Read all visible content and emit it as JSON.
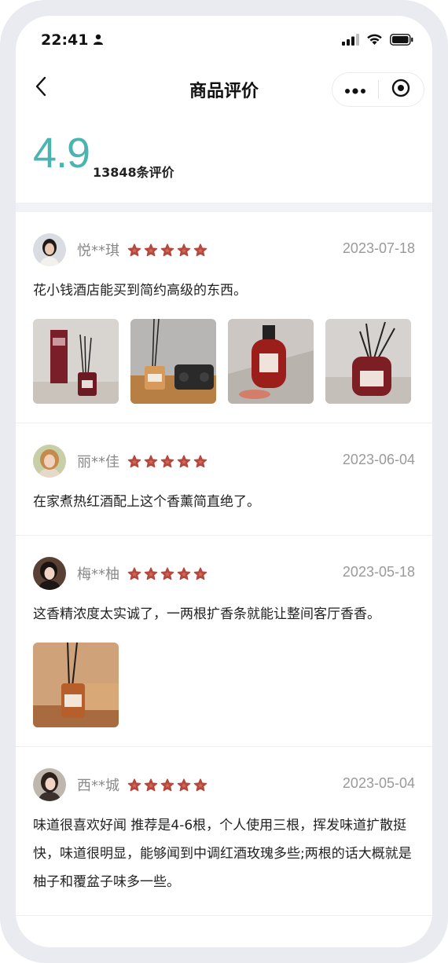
{
  "status_bar": {
    "time": "22:41"
  },
  "nav": {
    "title": "商品评价"
  },
  "summary": {
    "score": "4.9",
    "count": "13848条评价"
  },
  "colors": {
    "score": "#4bb3b0",
    "star": "#b4483c"
  },
  "reviews": [
    {
      "name": "悦**琪",
      "rating": 5,
      "date": "2023-07-18",
      "text": "花小钱酒店能买到简约高级的东西。",
      "photo_count": 4
    },
    {
      "name": "丽**佳",
      "rating": 5,
      "date": "2023-06-04",
      "text": "在家煮热红酒配上这个香薰简直绝了。",
      "photo_count": 0
    },
    {
      "name": "梅**柚",
      "rating": 5,
      "date": "2023-05-18",
      "text": "这香精浓度太实诚了，一两根扩香条就能让整间客厅香香。",
      "photo_count": 1
    },
    {
      "name": "西**城",
      "rating": 5,
      "date": "2023-05-04",
      "text": "味道很喜欢好闻 推荐是4-6根，个人使用三根，挥发味道扩散挺快，味道很明显，能够闻到中调红酒玫瑰多些;两根的话大概就是柚子和覆盆子味多一些。",
      "photo_count": 0
    }
  ]
}
